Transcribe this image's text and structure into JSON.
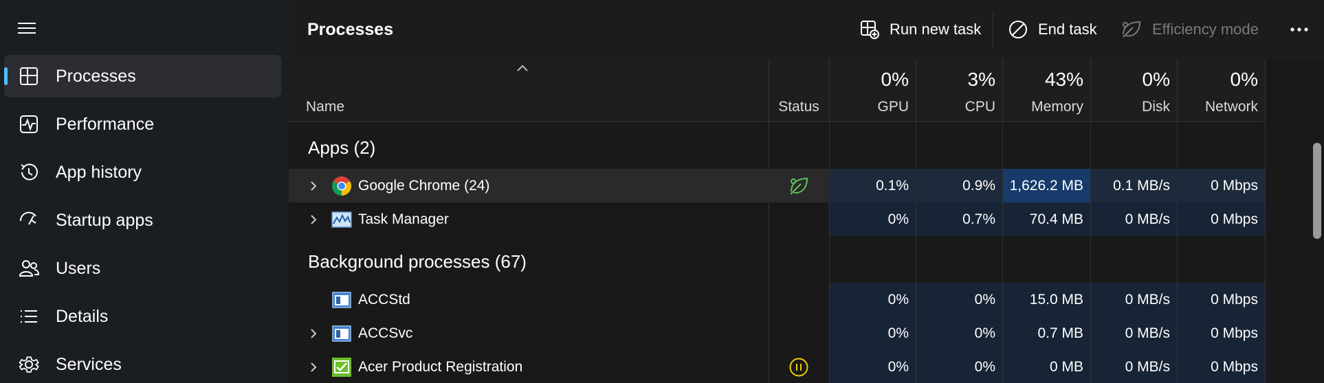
{
  "sidebar": {
    "items": [
      {
        "label": "Processes",
        "icon": "processes-icon",
        "active": true
      },
      {
        "label": "Performance",
        "icon": "performance-icon"
      },
      {
        "label": "App history",
        "icon": "history-icon"
      },
      {
        "label": "Startup apps",
        "icon": "startup-icon"
      },
      {
        "label": "Users",
        "icon": "users-icon"
      },
      {
        "label": "Details",
        "icon": "details-icon"
      },
      {
        "label": "Services",
        "icon": "services-icon"
      }
    ]
  },
  "toolbar": {
    "title": "Processes",
    "run_new_task": "Run new task",
    "end_task": "End task",
    "efficiency_mode": "Efficiency mode"
  },
  "columns": {
    "name": "Name",
    "status": "Status",
    "gpu": {
      "label": "GPU",
      "pct": "0%"
    },
    "cpu": {
      "label": "CPU",
      "pct": "3%"
    },
    "memory": {
      "label": "Memory",
      "pct": "43%"
    },
    "disk": {
      "label": "Disk",
      "pct": "0%"
    },
    "network": {
      "label": "Network",
      "pct": "0%"
    }
  },
  "groups": {
    "apps": "Apps (2)",
    "background": "Background processes (67)"
  },
  "rows": [
    {
      "name": "Google Chrome (24)",
      "gpu": "0.1%",
      "cpu": "0.9%",
      "memory": "1,626.2 MB",
      "disk": "0.1 MB/s",
      "network": "0 Mbps",
      "status": "efficiency-leaf-icon"
    },
    {
      "name": "Task Manager",
      "gpu": "0%",
      "cpu": "0.7%",
      "memory": "70.4 MB",
      "disk": "0 MB/s",
      "network": "0 Mbps"
    },
    {
      "name": "ACCStd",
      "gpu": "0%",
      "cpu": "0%",
      "memory": "15.0 MB",
      "disk": "0 MB/s",
      "network": "0 Mbps"
    },
    {
      "name": "ACCSvc",
      "gpu": "0%",
      "cpu": "0%",
      "memory": "0.7 MB",
      "disk": "0 MB/s",
      "network": "0 Mbps"
    },
    {
      "name": "Acer Product Registration",
      "gpu": "0%",
      "cpu": "0%",
      "memory": "0 MB",
      "disk": "0 MB/s",
      "network": "0 Mbps",
      "status": "suspended-pause-icon"
    }
  ],
  "colors": {
    "accent": "#4cc2ff",
    "heat_low": "#172436",
    "heat_mid": "#1d2a3b",
    "heat_high": "#173a6a",
    "efficiency_green": "#5fc15f",
    "suspended_yellow": "#f0d000"
  }
}
